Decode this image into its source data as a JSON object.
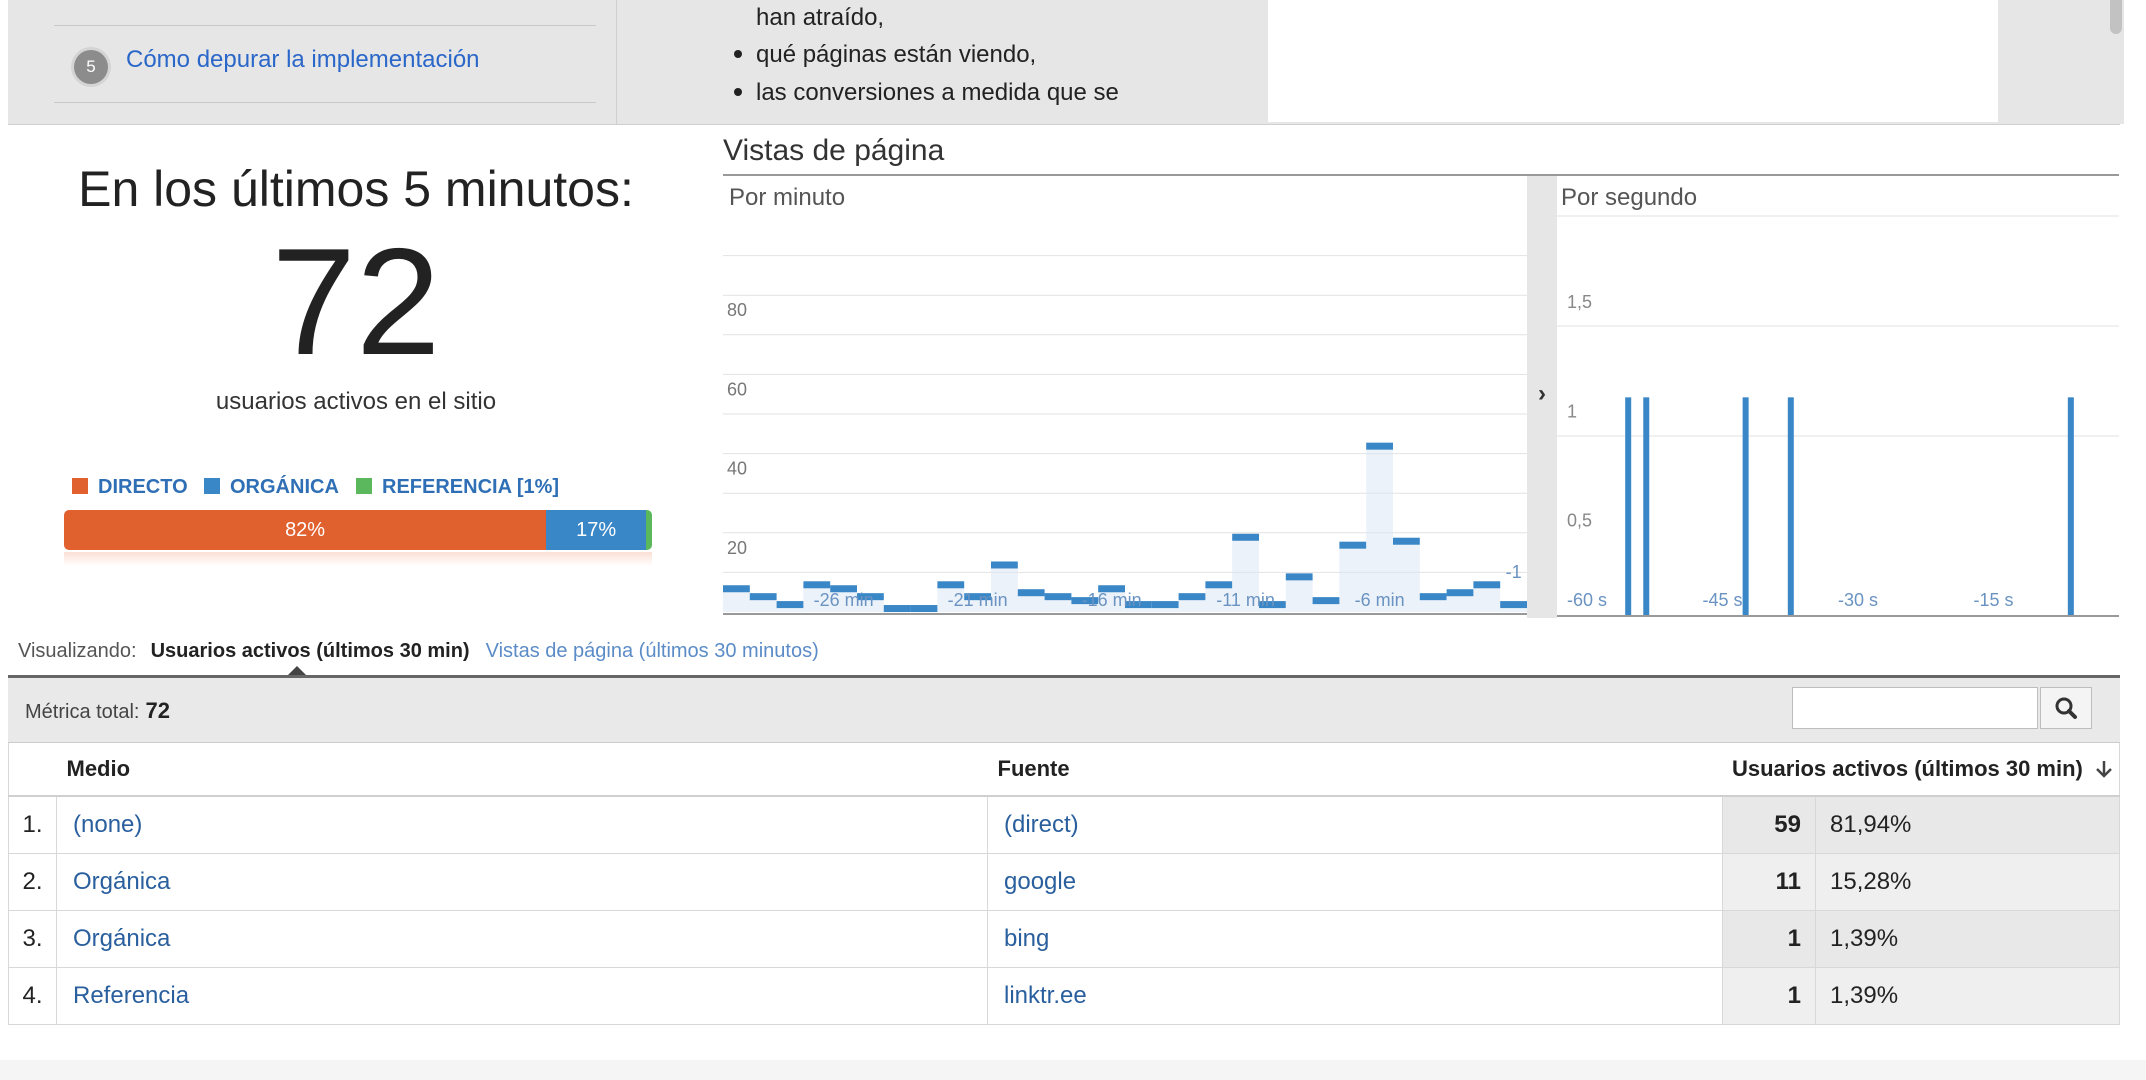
{
  "top_panel": {
    "step_number": "5",
    "step_link": "Cómo depurar la implementación",
    "text_lines": [
      "han atraído,",
      "qué páginas están viendo,",
      "las conversiones a medida que se"
    ]
  },
  "summary": {
    "heading": "En los últimos 5 minutos:",
    "active_users": "72",
    "subtitle": "usuarios activos en el sitio",
    "legend": [
      {
        "label": "DIRECTO",
        "color": "#e0602e"
      },
      {
        "label": "ORGÁNICA",
        "color": "#3a87c8"
      },
      {
        "label": "REFERENCIA [1%]",
        "color": "#5cb85c"
      }
    ],
    "bar": [
      {
        "label": "82%",
        "share": 82,
        "color": "#e0602e"
      },
      {
        "label": "17%",
        "share": 17,
        "color": "#3a87c8"
      },
      {
        "label": "",
        "share": 1,
        "color": "#5cb85c"
      }
    ]
  },
  "pageviews": {
    "title": "Vistas de página",
    "per_minute_label": "Por minuto",
    "per_second_label": "Por segundo",
    "expand_arrow": "›"
  },
  "chart_data": [
    {
      "type": "area",
      "title": "Por minuto",
      "ylim": [
        0,
        100
      ],
      "y_ticks": [
        "20",
        "40",
        "60",
        "80"
      ],
      "x_tick_labels": [
        "-26 min",
        "-21 min",
        "-16 min",
        "-11 min",
        "-6 min",
        "-1"
      ],
      "x": [
        -30,
        -29,
        -28,
        -27,
        -26,
        -25,
        -24,
        -23,
        -22,
        -21,
        -20,
        -19,
        -18,
        -17,
        -16,
        -15,
        -14,
        -13,
        -12,
        -11,
        -10,
        -9,
        -8,
        -7,
        -6,
        -5,
        -4,
        -3,
        -2,
        -1
      ],
      "values": [
        6,
        4,
        2,
        7,
        6,
        4,
        1,
        1,
        7,
        4,
        12,
        5,
        4,
        3,
        6,
        2,
        2,
        4,
        7,
        19,
        2,
        9,
        3,
        17,
        42,
        18,
        4,
        5,
        7,
        2
      ]
    },
    {
      "type": "bar",
      "title": "Por segundo",
      "ylim": [
        0,
        1.5
      ],
      "y_ticks": [
        "0,5",
        "1",
        "1,5"
      ],
      "x_tick_labels": [
        "-60 s",
        "-45 s",
        "-30 s",
        "-15 s"
      ],
      "x": [
        -60,
        -59,
        -58,
        -57,
        -56,
        -55,
        -54,
        -53,
        -52,
        -51,
        -50,
        -49,
        -48,
        -47,
        -46,
        -45,
        -44,
        -43,
        -42,
        -41,
        -40,
        -39,
        -38,
        -37,
        -36,
        -35,
        -34,
        -33,
        -32,
        -31,
        -30,
        -29,
        -28,
        -27,
        -26,
        -25,
        -24,
        -23,
        -22,
        -21,
        -20,
        -19,
        -18,
        -17,
        -16,
        -15,
        -14,
        -13,
        -12,
        -11,
        -10,
        -9,
        -8,
        -7,
        -6,
        -5,
        -4,
        -3,
        -2,
        -1
      ],
      "values": [
        0,
        0,
        0,
        0,
        0,
        0,
        1,
        0,
        1,
        0,
        0,
        0,
        0,
        0,
        0,
        0,
        0,
        0,
        0,
        1,
        0,
        0,
        0,
        0,
        1,
        0,
        0,
        0,
        0,
        0,
        0,
        0,
        0,
        0,
        0,
        0,
        0,
        0,
        0,
        0,
        0,
        0,
        0,
        0,
        0,
        0,
        0,
        0,
        0,
        0,
        0,
        0,
        0,
        0,
        0,
        1,
        0,
        0,
        0,
        0
      ],
      "color": "#3a87c8"
    }
  ],
  "viewing": {
    "label": "Visualizando:",
    "active_tab": "Usuarios activos (últimos 30 min)",
    "other_tab": "Vistas de página (últimos 30 minutos)"
  },
  "table": {
    "metric_label": "Métrica total:",
    "metric_value": "72",
    "headers": {
      "medio": "Medio",
      "fuente": "Fuente",
      "usuarios": "Usuarios activos (últimos 30 min)"
    },
    "rows": [
      {
        "idx": "1.",
        "medio": "(none)",
        "fuente": "(direct)",
        "count": "59",
        "pct": "81,94%"
      },
      {
        "idx": "2.",
        "medio": "Orgánica",
        "fuente": "google",
        "count": "11",
        "pct": "15,28%"
      },
      {
        "idx": "3.",
        "medio": "Orgánica",
        "fuente": "bing",
        "count": "1",
        "pct": "1,39%"
      },
      {
        "idx": "4.",
        "medio": "Referencia",
        "fuente": "linktr.ee",
        "count": "1",
        "pct": "1,39%"
      }
    ]
  }
}
